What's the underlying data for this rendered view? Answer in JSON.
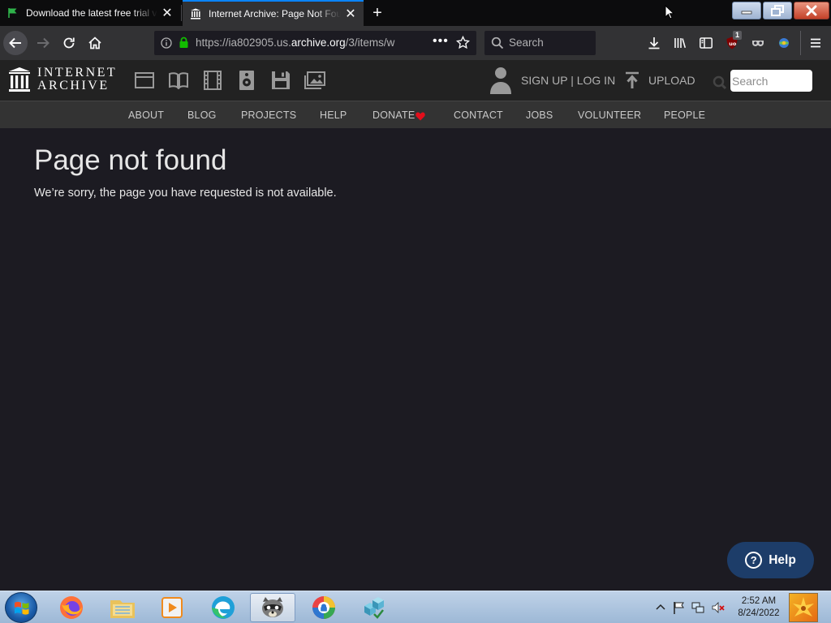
{
  "browser": {
    "tabs": [
      {
        "title": "Download the latest free trial v",
        "active": false,
        "icon": "green-flag-icon"
      },
      {
        "title": "Internet Archive: Page Not Fou",
        "active": true,
        "icon": "archive-icon"
      }
    ],
    "url": {
      "prefix": "https://ia802905.us.",
      "host": "archive.org",
      "path": "/3/items/w"
    },
    "search_placeholder": "Search",
    "ublock_badge": "1",
    "accent": "#0a84ff"
  },
  "ia": {
    "logo_line1": "INTERNET",
    "logo_line2": "ARCHIVE",
    "media_icons": [
      "web-icon",
      "texts-icon",
      "video-icon",
      "audio-icon",
      "software-icon",
      "images-icon"
    ],
    "signup_label": "SIGN UP | LOG IN",
    "upload_label": "UPLOAD",
    "search_placeholder": "Search",
    "nav": [
      "ABOUT",
      "BLOG",
      "PROJECTS",
      "HELP",
      "DONATE",
      "CONTACT",
      "JOBS",
      "VOLUNTEER",
      "PEOPLE"
    ],
    "donate_heart_color": "#e30e1b"
  },
  "content": {
    "title": "Page not found",
    "message": "We’re sorry, the page you have requested is not available.",
    "help_label": "Help"
  },
  "taskbar": {
    "apps": [
      "firefox-icon",
      "file-explorer-icon",
      "media-player-icon",
      "edge-icon",
      "raccoon-app-icon",
      "security-shield-icon",
      "cubes-app-icon"
    ],
    "time": "2:52 AM",
    "date": "8/24/2022"
  }
}
